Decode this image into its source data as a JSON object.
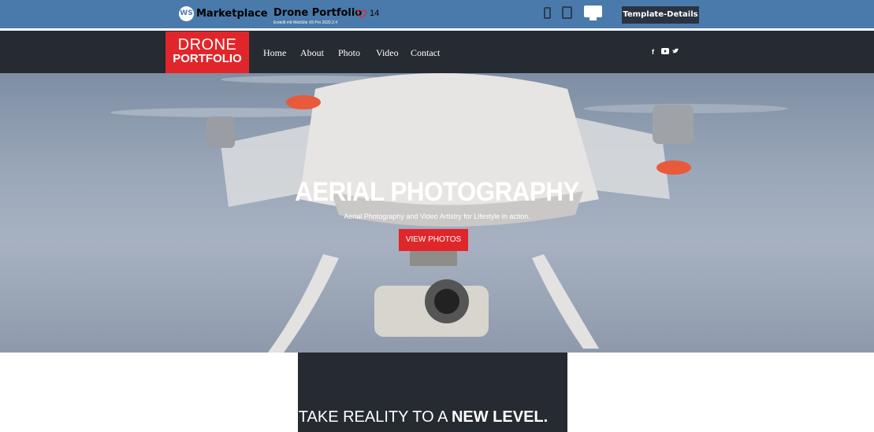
{
  "marketplace": {
    "logo_text": "WS",
    "name": "Marketplace",
    "template_title": "Drone Portfolio",
    "subtitle": "Erstellt mit WebSite X5 Pro 2020.2.4",
    "likes": "14",
    "template_details_label": "Template-Details",
    "devices": [
      "phone-icon",
      "tablet-icon",
      "desktop-icon"
    ],
    "accent_color": "#4a7aab"
  },
  "site": {
    "logo_line1": "DRONE",
    "logo_line2": "PORTFOLIO",
    "brand_color": "#e0262b",
    "nav": [
      "Home",
      "About",
      "Photo",
      "Video",
      "Contact"
    ],
    "social": [
      "facebook-icon",
      "youtube-icon",
      "twitter-icon"
    ]
  },
  "hero": {
    "title": "AERIAL PHOTOGRAPHY",
    "subtitle": "Aerial Photography and Video Artistry for Lifestyle in action.",
    "button_label": "VIEW PHOTOS"
  },
  "tagline": {
    "normal": "TAKE REALITY TO A ",
    "bold": "NEW LEVEL."
  }
}
